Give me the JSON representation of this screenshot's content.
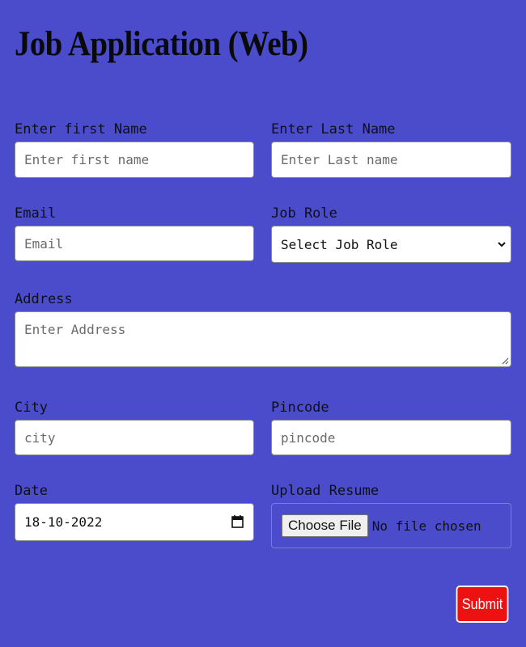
{
  "page": {
    "title": "Job Application (Web)"
  },
  "form": {
    "first_name": {
      "label": "Enter first Name",
      "placeholder": "Enter first name"
    },
    "last_name": {
      "label": "Enter Last Name",
      "placeholder": "Enter Last name"
    },
    "email": {
      "label": "Email",
      "placeholder": "Email"
    },
    "job_role": {
      "label": "Job Role",
      "selected": "Select Job Role"
    },
    "address": {
      "label": "Address",
      "placeholder": "Enter Address"
    },
    "city": {
      "label": "City",
      "placeholder": "city"
    },
    "pincode": {
      "label": "Pincode",
      "placeholder": "pincode"
    },
    "date": {
      "label": "Date",
      "value": "18-10-2022"
    },
    "resume": {
      "label": "Upload Resume",
      "button_label": "Choose File",
      "status": "No file chosen"
    },
    "submit_label": "Submit"
  },
  "icons": {
    "select_arrow": "chevron-down-icon",
    "date_picker": "calendar-icon",
    "resize": "resize-grip-icon"
  },
  "colors": {
    "background": "#4b4ccb",
    "submit_bg": "#ee1111",
    "field_bg": "#ffffff"
  }
}
